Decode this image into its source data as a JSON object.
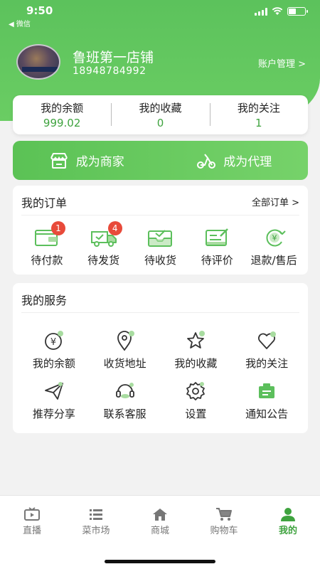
{
  "status_bar": {
    "time": "9:50",
    "back_label": "◀ 微信"
  },
  "profile": {
    "store_name": "鲁班第一店铺",
    "phone": "18948784992",
    "account_mgmt": "账户管理 >"
  },
  "stats": [
    {
      "label": "我的余额",
      "value": "999.02"
    },
    {
      "label": "我的收藏",
      "value": "0"
    },
    {
      "label": "我的关注",
      "value": "1"
    }
  ],
  "banner": {
    "merchant": "成为商家",
    "agent": "成为代理"
  },
  "orders": {
    "title": "我的订单",
    "all_link": "全部订单 >",
    "items": [
      {
        "label": "待付款",
        "icon": "wallet-icon",
        "badge": "1"
      },
      {
        "label": "待发货",
        "icon": "truck-icon",
        "badge": "4"
      },
      {
        "label": "待收货",
        "icon": "received-icon",
        "badge": ""
      },
      {
        "label": "待评价",
        "icon": "review-icon",
        "badge": ""
      },
      {
        "label": "退款/售后",
        "icon": "refund-icon",
        "badge": ""
      }
    ]
  },
  "services": {
    "title": "我的服务",
    "items": [
      {
        "label": "我的余额",
        "icon": "yen-circle-icon"
      },
      {
        "label": "收货地址",
        "icon": "location-pin-icon"
      },
      {
        "label": "我的收藏",
        "icon": "star-icon"
      },
      {
        "label": "我的关注",
        "icon": "heart-icon"
      },
      {
        "label": "推荐分享",
        "icon": "paper-plane-icon"
      },
      {
        "label": "联系客服",
        "icon": "headset-icon"
      },
      {
        "label": "设置",
        "icon": "gear-icon"
      },
      {
        "label": "通知公告",
        "icon": "notice-icon"
      }
    ]
  },
  "nav": {
    "items": [
      {
        "label": "直播",
        "icon": "tv-icon"
      },
      {
        "label": "菜市场",
        "icon": "list-icon"
      },
      {
        "label": "商城",
        "icon": "home-icon"
      },
      {
        "label": "购物车",
        "icon": "cart-icon"
      },
      {
        "label": "我的",
        "icon": "person-icon"
      }
    ],
    "active_index": 4
  },
  "colors": {
    "brand_green": "#5cc25c",
    "value_green": "#3fa33f",
    "badge_red": "#e84a3a"
  }
}
